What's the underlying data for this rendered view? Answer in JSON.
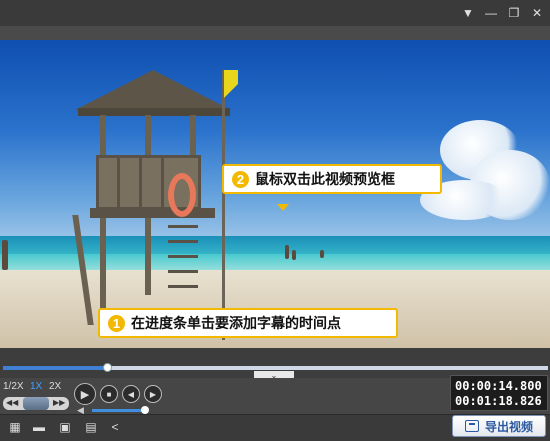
{
  "window": {
    "menu_icon": "▼",
    "minimize_icon": "—",
    "maximize_icon": "❐",
    "close_icon": "✕"
  },
  "callouts": [
    {
      "number": "2",
      "text": "鼠标双击此视频预览框"
    },
    {
      "number": "1",
      "text": "在进度条单击要添加字幕的时间点"
    }
  ],
  "player": {
    "progress_fraction": 0.19,
    "collapse_icon": "⌄",
    "speeds": [
      "1/2X",
      "1X",
      "2X"
    ],
    "active_speed": "1X",
    "slider_left": "◀◀",
    "slider_right": "▶▶",
    "play_icon": "▶",
    "stop_icon": "■",
    "prev_icon": "◀",
    "next_icon": "▶",
    "volume_icon": "◀",
    "volume_fraction": 0.95,
    "current_time": "00:00:14.800",
    "total_time": "00:01:18.826"
  },
  "toolbar": {
    "icons": [
      "new-project-icon",
      "open-folder-icon",
      "save-icon",
      "save-as-icon",
      "share-icon"
    ],
    "icon_glyphs": [
      "▦",
      "▬",
      "▣",
      "▤",
      "<"
    ],
    "export_label": "导出视频"
  },
  "colors": {
    "accent": "#f2b900",
    "progress": "#3f7fd4",
    "export_text": "#2b5aa0"
  }
}
